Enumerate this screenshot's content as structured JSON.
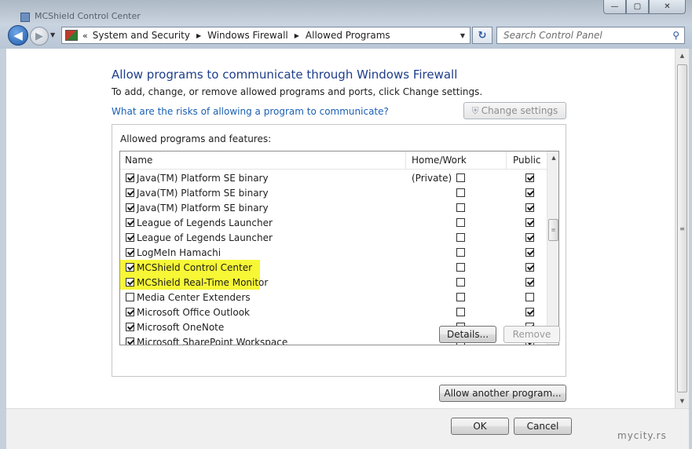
{
  "window": {
    "title": "MCShield Control Center",
    "controls": {
      "minimize": "—",
      "maximize": "▢",
      "close": "✕"
    }
  },
  "navbar": {
    "back_glyph": "◀",
    "forward_glyph": "▶",
    "recent_glyph": "▼",
    "address_overflow": "«",
    "breadcrumbs": [
      "System and Security",
      "Windows Firewall",
      "Allowed Programs"
    ],
    "breadcrumb_sep": "▶",
    "dropdown_glyph": "▼",
    "refresh_glyph": "↻",
    "search": {
      "placeholder": "Search Control Panel",
      "icon": "search-icon",
      "glyph": "⚲"
    }
  },
  "main": {
    "title": "Allow programs to communicate through Windows Firewall",
    "description": "To add, change, or remove allowed programs and ports, click Change settings.",
    "risk_link": "What are the risks of allowing a program to communicate?",
    "change_settings_label": "Change settings",
    "shield_glyph": "⛨",
    "group_label": "Allowed programs and features:",
    "columns": {
      "name": "Name",
      "home": "Home/Work (Private)",
      "public": "Public"
    },
    "programs": [
      {
        "name": "Java(TM) Platform SE binary",
        "enabled": true,
        "home": false,
        "public": true,
        "highlight": false
      },
      {
        "name": "Java(TM) Platform SE binary",
        "enabled": true,
        "home": false,
        "public": true,
        "highlight": false
      },
      {
        "name": "Java(TM) Platform SE binary",
        "enabled": true,
        "home": false,
        "public": true,
        "highlight": false
      },
      {
        "name": "League of Legends Launcher",
        "enabled": true,
        "home": false,
        "public": true,
        "highlight": false
      },
      {
        "name": "League of Legends Launcher",
        "enabled": true,
        "home": false,
        "public": true,
        "highlight": false
      },
      {
        "name": "LogMeIn Hamachi",
        "enabled": true,
        "home": false,
        "public": true,
        "highlight": false
      },
      {
        "name": "MCShield Control Center",
        "enabled": true,
        "home": false,
        "public": true,
        "highlight": true
      },
      {
        "name": "MCShield Real-Time Monitor",
        "enabled": true,
        "home": false,
        "public": true,
        "highlight": true
      },
      {
        "name": "Media Center Extenders",
        "enabled": false,
        "home": false,
        "public": false,
        "highlight": false
      },
      {
        "name": "Microsoft Office Outlook",
        "enabled": true,
        "home": false,
        "public": true,
        "highlight": false
      },
      {
        "name": "Microsoft OneNote",
        "enabled": true,
        "home": false,
        "public": true,
        "highlight": false
      },
      {
        "name": "Microsoft SharePoint Workspace",
        "enabled": true,
        "home": false,
        "public": true,
        "highlight": false
      }
    ],
    "list_scroll": {
      "up": "▲",
      "down": "▼",
      "grip": "≡"
    },
    "details_label": "Details...",
    "remove_label": "Remove",
    "allow_another_label": "Allow another program..."
  },
  "page_scroll": {
    "up": "▲",
    "down": "▼",
    "grip": "≡"
  },
  "footer": {
    "ok_label": "OK",
    "cancel_label": "Cancel"
  },
  "watermark": "mycity.rs",
  "colors": {
    "highlight": "#f7f736",
    "title_blue": "#1e3e8a",
    "link_blue": "#1a5fb4"
  }
}
